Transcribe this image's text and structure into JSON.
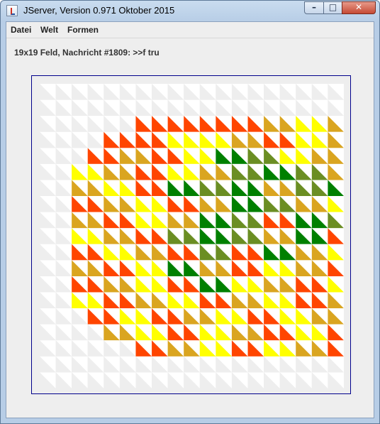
{
  "window": {
    "title": "JServer, Version 0.971 Oktober 2015",
    "controls": [
      "minimize",
      "maximize",
      "close"
    ],
    "icons": {
      "app": "java-cup-icon",
      "minimize": "minimize-icon",
      "maximize": "maximize-icon",
      "close": "close-icon"
    }
  },
  "menu": {
    "items": [
      {
        "label": "Datei"
      },
      {
        "label": "Welt"
      },
      {
        "label": "Formen"
      }
    ]
  },
  "status": {
    "message": "19x19 Feld, Nachricht #1809: >>f tru"
  },
  "board": {
    "size": 19,
    "colors": {
      "background": "#ffffff",
      "empty": "#eeeeee",
      "frame": "#00008b",
      "F": "#ff4500",
      "G": "#daa520",
      "Y": "#ffff00",
      "D": "#008000",
      "O": "#6b8e23"
    },
    "rows": [
      ".........................................................",
      "...............................................................................",
      "......FFFFFFFFGGYYGG.....",
      "....FFFFYYYYGGFFYYGGFF...",
      "...FFGGFFYYDDOOYYGGFFYY..",
      "..YYGGFFYYGGOODDOOGGFFYY.",
      "..GGYYFFDDOODDGGOODDYYGGF",
      "..FFGGYYFFGGDDOOGGYYFFGGY",
      "..GGFFYYGGDDOOFFDDOOYYFFG",
      "..YYGGFFOODDOOGGDDFFGGYYF",
      "..FFYYGGFFOOFFDDGGYYFFGGY",
      "..GGFFYYDDGGFFYYGGFFYYFFG",
      "..FFGGYYFFDDYYGGFFYYGGFFY",
      "..YYFFGGYYFFGGYYFFGGFFYY.",
      "...FFYYFFGGYYFFYYGGFFGG..",
      "....GGYYFFYYGGFFYYFFYY...",
      "......FFGGYYFFYYGGFF.....",
      ".........................",
      "........................."
    ]
  }
}
